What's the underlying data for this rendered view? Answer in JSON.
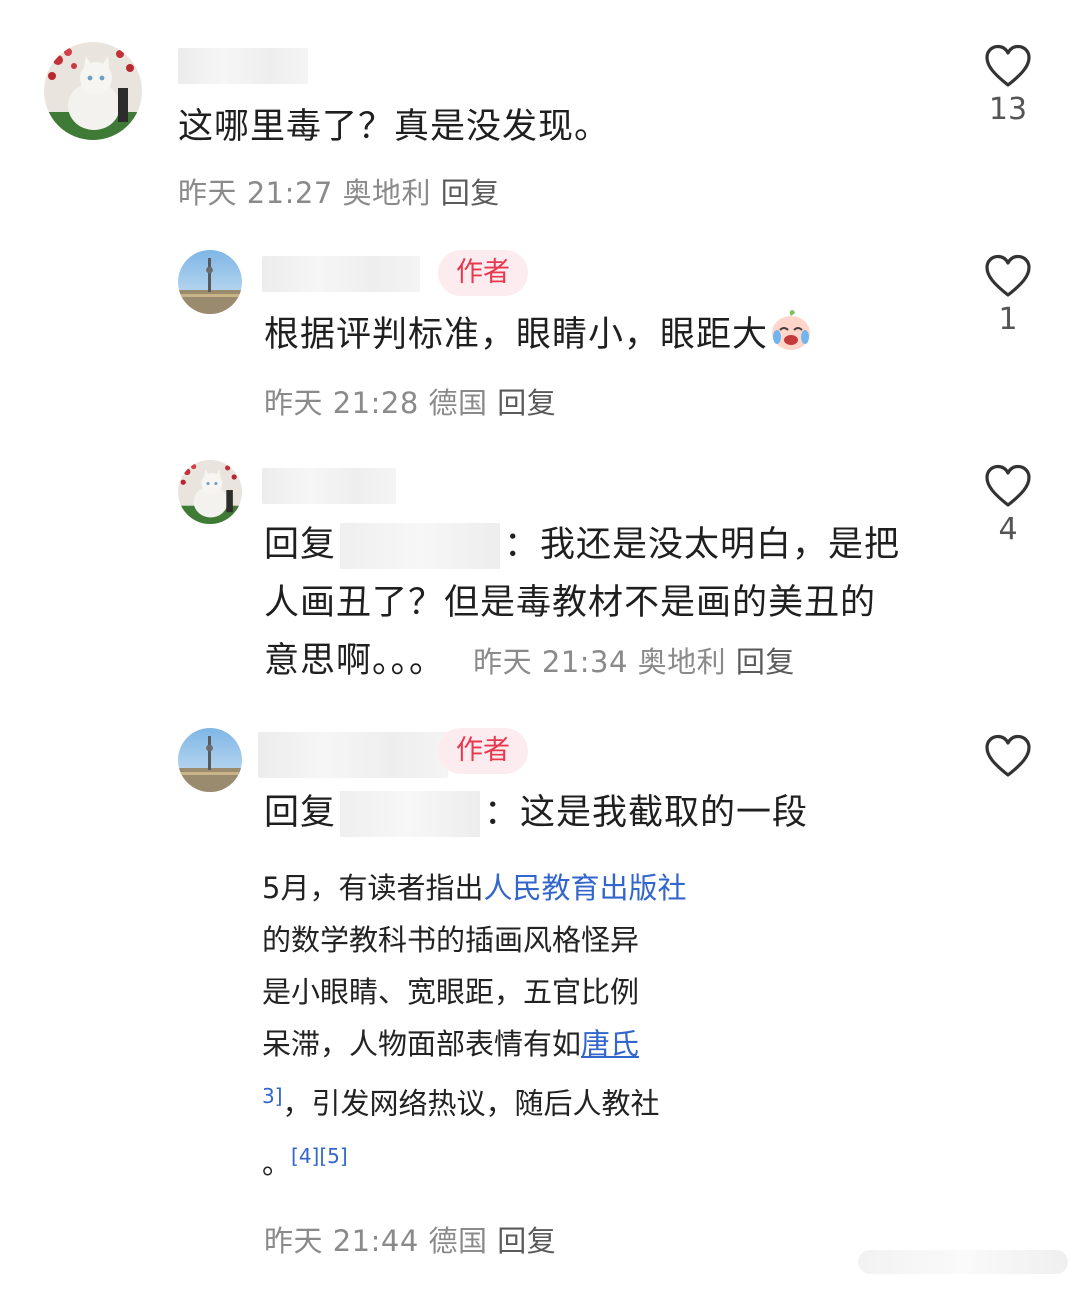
{
  "comments": [
    {
      "text": "这哪里毒了？真是没发现。",
      "time": "昨天 21:27",
      "location": "奥地利",
      "reply_label": "回复",
      "likes": "13",
      "avatar": "cat-avatar"
    },
    {
      "author_tag": "作者",
      "text": "根据评判标准，眼睛小，眼距大",
      "emoji": "laughing-crying-peach-emoji",
      "time": "昨天 21:28",
      "location": "德国",
      "reply_label": "回复",
      "likes": "1",
      "avatar": "tower-avatar"
    },
    {
      "reply_prefix": "回复",
      "text_a": "：我还是没太明白，是把",
      "text_b": "人画丑了？但是毒教材不是画的美丑的",
      "text_c": "意思啊。。。",
      "time": "昨天 21:34",
      "location": "奥地利",
      "reply_label": "回复",
      "likes": "4",
      "avatar": "cat-avatar"
    },
    {
      "author_tag": "作者",
      "reply_prefix": "回复",
      "text": "：这是我截取的一段",
      "time": "昨天 21:44",
      "location": "德国",
      "reply_label": "回复",
      "likes": "",
      "avatar": "tower-avatar"
    }
  ],
  "screenshot_excerpt": {
    "line1_a": "5月，有读者指出",
    "line1_link": "人民教育出版社",
    "line2": "的数学教科书的插画风格怪异",
    "line3": "是小眼睛、宽眼距，五官比例",
    "line4_a": "呆滞，人物面部表情有如",
    "line4_link": "唐氏",
    "line5_ref": "3]",
    "line5_text": "，引发网络热议，随后人教社",
    "line6_text": "。",
    "line6_refs": "[4][5]"
  },
  "colors": {
    "author_tag_bg": "#fdecef",
    "author_tag_text": "#e8384f",
    "meta_text": "#8a8a8a",
    "link": "#3366cc"
  }
}
